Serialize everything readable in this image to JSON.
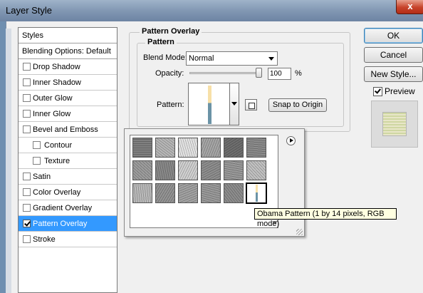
{
  "window": {
    "title": "Layer Style",
    "close_glyph": "x"
  },
  "styles_panel": {
    "header": "Styles",
    "blending_options": "Blending Options: Default",
    "items": [
      {
        "label": "Drop Shadow",
        "checked": false,
        "sub": false
      },
      {
        "label": "Inner Shadow",
        "checked": false,
        "sub": false
      },
      {
        "label": "Outer Glow",
        "checked": false,
        "sub": false
      },
      {
        "label": "Inner Glow",
        "checked": false,
        "sub": false
      },
      {
        "label": "Bevel and Emboss",
        "checked": false,
        "sub": false
      },
      {
        "label": "Contour",
        "checked": false,
        "sub": true
      },
      {
        "label": "Texture",
        "checked": false,
        "sub": true
      },
      {
        "label": "Satin",
        "checked": false,
        "sub": false
      },
      {
        "label": "Color Overlay",
        "checked": false,
        "sub": false
      },
      {
        "label": "Gradient Overlay",
        "checked": false,
        "sub": false
      },
      {
        "label": "Pattern Overlay",
        "checked": true,
        "sub": false,
        "active": true
      },
      {
        "label": "Stroke",
        "checked": false,
        "sub": false
      }
    ]
  },
  "pattern_overlay": {
    "group_title": "Pattern Overlay",
    "inner_title": "Pattern",
    "blend_mode_label": "Blend Mode:",
    "blend_mode_value": "Normal",
    "opacity_label": "Opacity:",
    "opacity_value": "100",
    "opacity_fraction": 1.0,
    "opacity_unit": "%",
    "pattern_label": "Pattern:",
    "snap_button": "Snap to Origin"
  },
  "picker": {
    "tooltip": "Obama Pattern (1 by 14 pixels, RGB mode)",
    "tiles": [
      "#808080",
      "#b8b8b8",
      "#e4e4e4",
      "#a7a7a7",
      "#6f6f6f",
      "#8c8c8c",
      "#9e9e9e",
      "#8a8a8a",
      "#d2d2d2",
      "#8f8f8f",
      "#9a9a9a",
      "#c3c3c3",
      "#bbbbbb",
      "#959595",
      "#a3a3a3",
      "#9b9b9b",
      "#8e8e8e"
    ]
  },
  "buttons": {
    "ok": "OK",
    "cancel": "Cancel",
    "new_style": "New Style...",
    "preview": "Preview"
  },
  "colors": {
    "selection": "#3399ff",
    "tooltip_bg": "#ffffe1",
    "pattern_top": "#f7e0a8",
    "pattern_bottom": "#6b93a6"
  }
}
